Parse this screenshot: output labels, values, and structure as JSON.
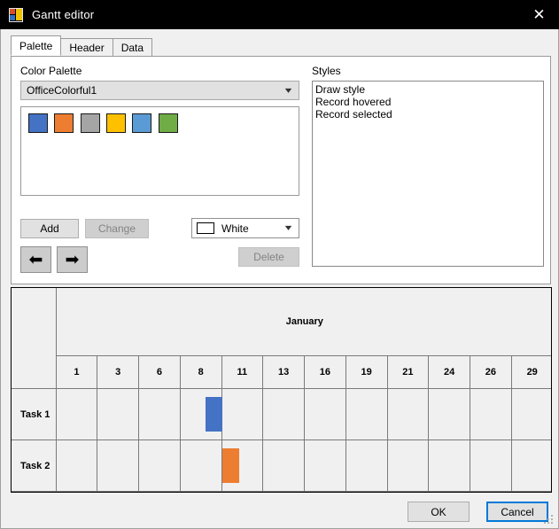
{
  "window": {
    "title": "Gantt editor",
    "icon": "app-window-icon",
    "close_label": "✕"
  },
  "tabs": [
    {
      "label": "Palette",
      "active": true
    },
    {
      "label": "Header",
      "active": false
    },
    {
      "label": "Data",
      "active": false
    }
  ],
  "palette_panel": {
    "color_palette_label": "Color Palette",
    "palette_combo_value": "OfficeColorful1",
    "swatches": [
      {
        "name": "blue",
        "hex": "#4472C4"
      },
      {
        "name": "orange",
        "hex": "#ED7D31"
      },
      {
        "name": "gray",
        "hex": "#A5A5A5"
      },
      {
        "name": "yellow",
        "hex": "#FFC000"
      },
      {
        "name": "light-blue",
        "hex": "#5B9BD5"
      },
      {
        "name": "green",
        "hex": "#70AD47"
      }
    ],
    "add_label": "Add",
    "change_label": "Change",
    "delete_label": "Delete",
    "move_left_glyph": "⬅",
    "move_right_glyph": "➡",
    "color_combo_value": "White",
    "color_combo_chip_hex": "#FFFFFF",
    "chevron_glyph": "⌄"
  },
  "styles_panel": {
    "styles_label": "Styles",
    "items": [
      "Draw style",
      "Record hovered",
      "Record selected"
    ]
  },
  "gantt": {
    "month": "January",
    "days": [
      "1",
      "3",
      "6",
      "8",
      "11",
      "13",
      "16",
      "19",
      "21",
      "24",
      "26",
      "29"
    ],
    "rows": [
      {
        "label": "Task 1",
        "bar_color": "#4472C4",
        "bar_column": 4,
        "bar_side": "right"
      },
      {
        "label": "Task 2",
        "bar_color": "#ED7D31",
        "bar_column": 5,
        "bar_side": "left"
      }
    ]
  },
  "footer": {
    "ok_label": "OK",
    "cancel_label": "Cancel",
    "focused_button": "Cancel"
  }
}
